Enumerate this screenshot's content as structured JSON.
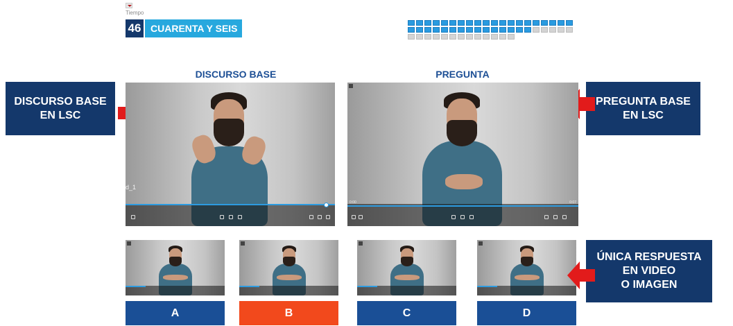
{
  "timer": {
    "label": "Tiempo",
    "value": "46",
    "value_words": "CUARENTA Y SEIS"
  },
  "progress": {
    "total": 53,
    "completed": 35,
    "colors": {
      "completed": "#2a9be0",
      "pending": "#d4d4d4"
    }
  },
  "discourse": {
    "title": "DISCURSO BASE",
    "video_caption": "d_1",
    "playback_fraction": 0.95
  },
  "question": {
    "title": "PREGUNTA",
    "playback_fraction": 1.0,
    "time_start": "0:00",
    "time_end": "0:07"
  },
  "callouts": {
    "left_discourse": [
      "DISCURSO BASE",
      "EN LSC"
    ],
    "right_question": [
      "PREGUNTA BASE",
      "EN LSC"
    ],
    "right_answer": [
      "ÚNICA RESPUESTA",
      "EN VIDEO",
      "O IMAGEN"
    ]
  },
  "answers": [
    {
      "label": "A",
      "selected": false,
      "color": "#1a4f96"
    },
    {
      "label": "B",
      "selected": true,
      "color": "#f2491c"
    },
    {
      "label": "C",
      "selected": false,
      "color": "#1a4f96"
    },
    {
      "label": "D",
      "selected": false,
      "color": "#1a4f96"
    }
  ],
  "colors": {
    "navy": "#14386b",
    "title_blue": "#1d4f95",
    "cyan": "#27a8de",
    "arrow_red": "#e21b1b"
  },
  "icons": {
    "collapse": "chevron-down-icon",
    "callout_arrow": "arrow-icon",
    "video_controls": [
      "subtitles-icon",
      "rewind-icon",
      "play-icon",
      "forward-icon",
      "edit-icon",
      "pip-icon",
      "fullscreen-icon"
    ]
  }
}
